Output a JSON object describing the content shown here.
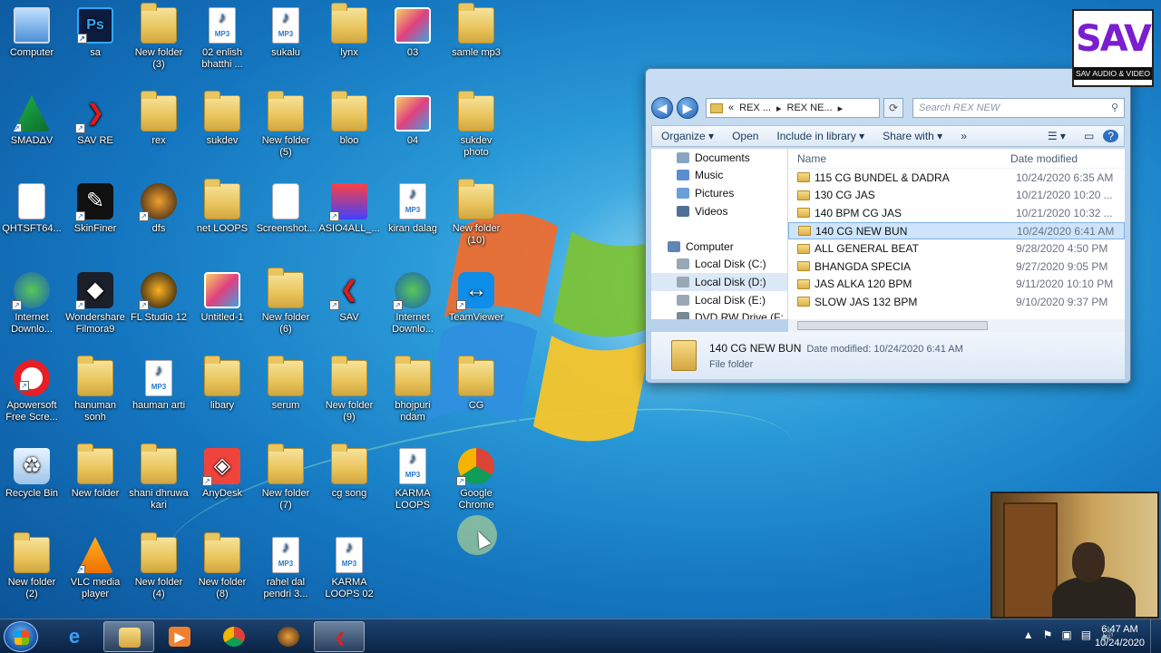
{
  "desktop": {
    "icons": [
      {
        "label": "Computer",
        "kind": "computer"
      },
      {
        "label": "sa",
        "kind": "ps"
      },
      {
        "label": "New folder\n(3)",
        "kind": "folder"
      },
      {
        "label": "02 enlish\nbhatthi ...",
        "kind": "mp3"
      },
      {
        "label": "sukalu",
        "kind": "mp3"
      },
      {
        "label": "lynx",
        "kind": "folder"
      },
      {
        "label": "03",
        "kind": "image"
      },
      {
        "label": "samle mp3",
        "kind": "folder"
      },
      {
        "label": "SMADΔV",
        "kind": "smadav"
      },
      {
        "label": "SAV RE",
        "kind": "savre"
      },
      {
        "label": "rex",
        "kind": "folder"
      },
      {
        "label": "sukdev",
        "kind": "folder"
      },
      {
        "label": "New folder\n(5)",
        "kind": "folder"
      },
      {
        "label": "bloo",
        "kind": "folder"
      },
      {
        "label": "04",
        "kind": "image"
      },
      {
        "label": "sukdev\nphoto",
        "kind": "folder"
      },
      {
        "label": "QHTSFT64...",
        "kind": "file"
      },
      {
        "label": "SkinFiner",
        "kind": "skinfiner"
      },
      {
        "label": "dfs",
        "kind": "dfs"
      },
      {
        "label": "net LOOPS",
        "kind": "folder"
      },
      {
        "label": "Screenshot...",
        "kind": "doc"
      },
      {
        "label": "ASIO4ALL_...",
        "kind": "asio"
      },
      {
        "label": "kiran dalag",
        "kind": "mp3"
      },
      {
        "label": "New folder\n(10)",
        "kind": "folder"
      },
      {
        "label": "Internet\nDownlo...",
        "kind": "idm"
      },
      {
        "label": "Wondershare\nFilmora9",
        "kind": "filmora"
      },
      {
        "label": "FL Studio 12",
        "kind": "fl"
      },
      {
        "label": "Untitled-1",
        "kind": "image"
      },
      {
        "label": "New folder\n(6)",
        "kind": "folder"
      },
      {
        "label": "SAV",
        "kind": "sav"
      },
      {
        "label": "Internet\nDownlo...",
        "kind": "idm"
      },
      {
        "label": "TeamViewer",
        "kind": "teamviewer"
      },
      {
        "label": "Apowersoft\nFree Scre...",
        "kind": "apowersoft"
      },
      {
        "label": "hanuman\nsonh",
        "kind": "folder"
      },
      {
        "label": "hauman arti",
        "kind": "mp3"
      },
      {
        "label": "libary",
        "kind": "folder"
      },
      {
        "label": "serum",
        "kind": "folder"
      },
      {
        "label": "New folder\n(9)",
        "kind": "folder"
      },
      {
        "label": "bhojpuri\nndam",
        "kind": "folder"
      },
      {
        "label": "CG",
        "kind": "folder"
      },
      {
        "label": "Recycle Bin",
        "kind": "recycle"
      },
      {
        "label": "New folder",
        "kind": "folder"
      },
      {
        "label": "shani dhruwa\nkari",
        "kind": "folder"
      },
      {
        "label": "AnyDesk",
        "kind": "anydesk"
      },
      {
        "label": "New folder\n(7)",
        "kind": "folder"
      },
      {
        "label": "cg song",
        "kind": "folder"
      },
      {
        "label": "KARMA\nLOOPS",
        "kind": "mp3"
      },
      {
        "label": "Google\nChrome",
        "kind": "chrome"
      },
      {
        "label": "New folder\n(2)",
        "kind": "folder"
      },
      {
        "label": "VLC media\nplayer",
        "kind": "vlc"
      },
      {
        "label": "New folder\n(4)",
        "kind": "folder"
      },
      {
        "label": "New folder\n(8)",
        "kind": "folder"
      },
      {
        "label": "rahel dal\npendri 3...",
        "kind": "mp3"
      },
      {
        "label": "KARMA\nLOOPS 02",
        "kind": "mp3"
      }
    ],
    "mp3_tag": "MP3",
    "note_glyph": "♪"
  },
  "explorer": {
    "breadcrumb": [
      "«",
      "REX ...",
      "▸",
      "REX NE...",
      "▸"
    ],
    "search_placeholder": "Search REX NEW",
    "toolbar": {
      "organize": "Organize ▾",
      "open": "Open",
      "include": "Include in library ▾",
      "share": "Share with ▾",
      "more": "»"
    },
    "nav_tree": [
      {
        "label": "Documents",
        "color": "#8aa5c4"
      },
      {
        "label": "Music",
        "color": "#5a8ed0"
      },
      {
        "label": "Pictures",
        "color": "#6a9fd8"
      },
      {
        "label": "Videos",
        "color": "#50709a"
      },
      {
        "label": "",
        "color": ""
      },
      {
        "label": "Computer",
        "color": "#5e86b6"
      },
      {
        "label": "Local Disk (C:)",
        "color": "#9aa8b6"
      },
      {
        "label": "Local Disk (D:)",
        "color": "#9aa8b6"
      },
      {
        "label": "Local Disk (E:)",
        "color": "#9aa8b6"
      },
      {
        "label": "DVD RW Drive (F:",
        "color": "#7a8794"
      }
    ],
    "columns": {
      "name": "Name",
      "date": "Date modified"
    },
    "files": [
      {
        "name": "115 CG BUNDEL & DADRA",
        "date": "10/24/2020 6:35 AM"
      },
      {
        "name": "130 CG JAS",
        "date": "10/21/2020 10:20 ..."
      },
      {
        "name": "140 BPM CG JAS",
        "date": "10/21/2020 10:32 ..."
      },
      {
        "name": "140 CG NEW BUN",
        "date": "10/24/2020 6:41 AM",
        "selected": true
      },
      {
        "name": "ALL GENERAL BEAT",
        "date": "9/28/2020 4:50 PM"
      },
      {
        "name": "BHANGDA SPECIA",
        "date": "9/27/2020 9:05 PM"
      },
      {
        "name": "JAS ALKA 120 BPM",
        "date": "9/11/2020 10:10 PM"
      },
      {
        "name": "SLOW JAS 132 BPM",
        "date": "9/10/2020 9:37 PM"
      }
    ],
    "details": {
      "name": "140 CG NEW BUN",
      "modified": "Date modified: 10/24/2020 6:41 AM",
      "type": "File folder"
    }
  },
  "logo": {
    "text": "SAV",
    "subtitle": "SAV AUDIO & VIDEO"
  },
  "taskbar": {
    "time": "6:47 AM",
    "date": "10/24/2020",
    "tray": [
      "▲",
      "⚑",
      "▣",
      "▤",
      "🔊"
    ]
  }
}
